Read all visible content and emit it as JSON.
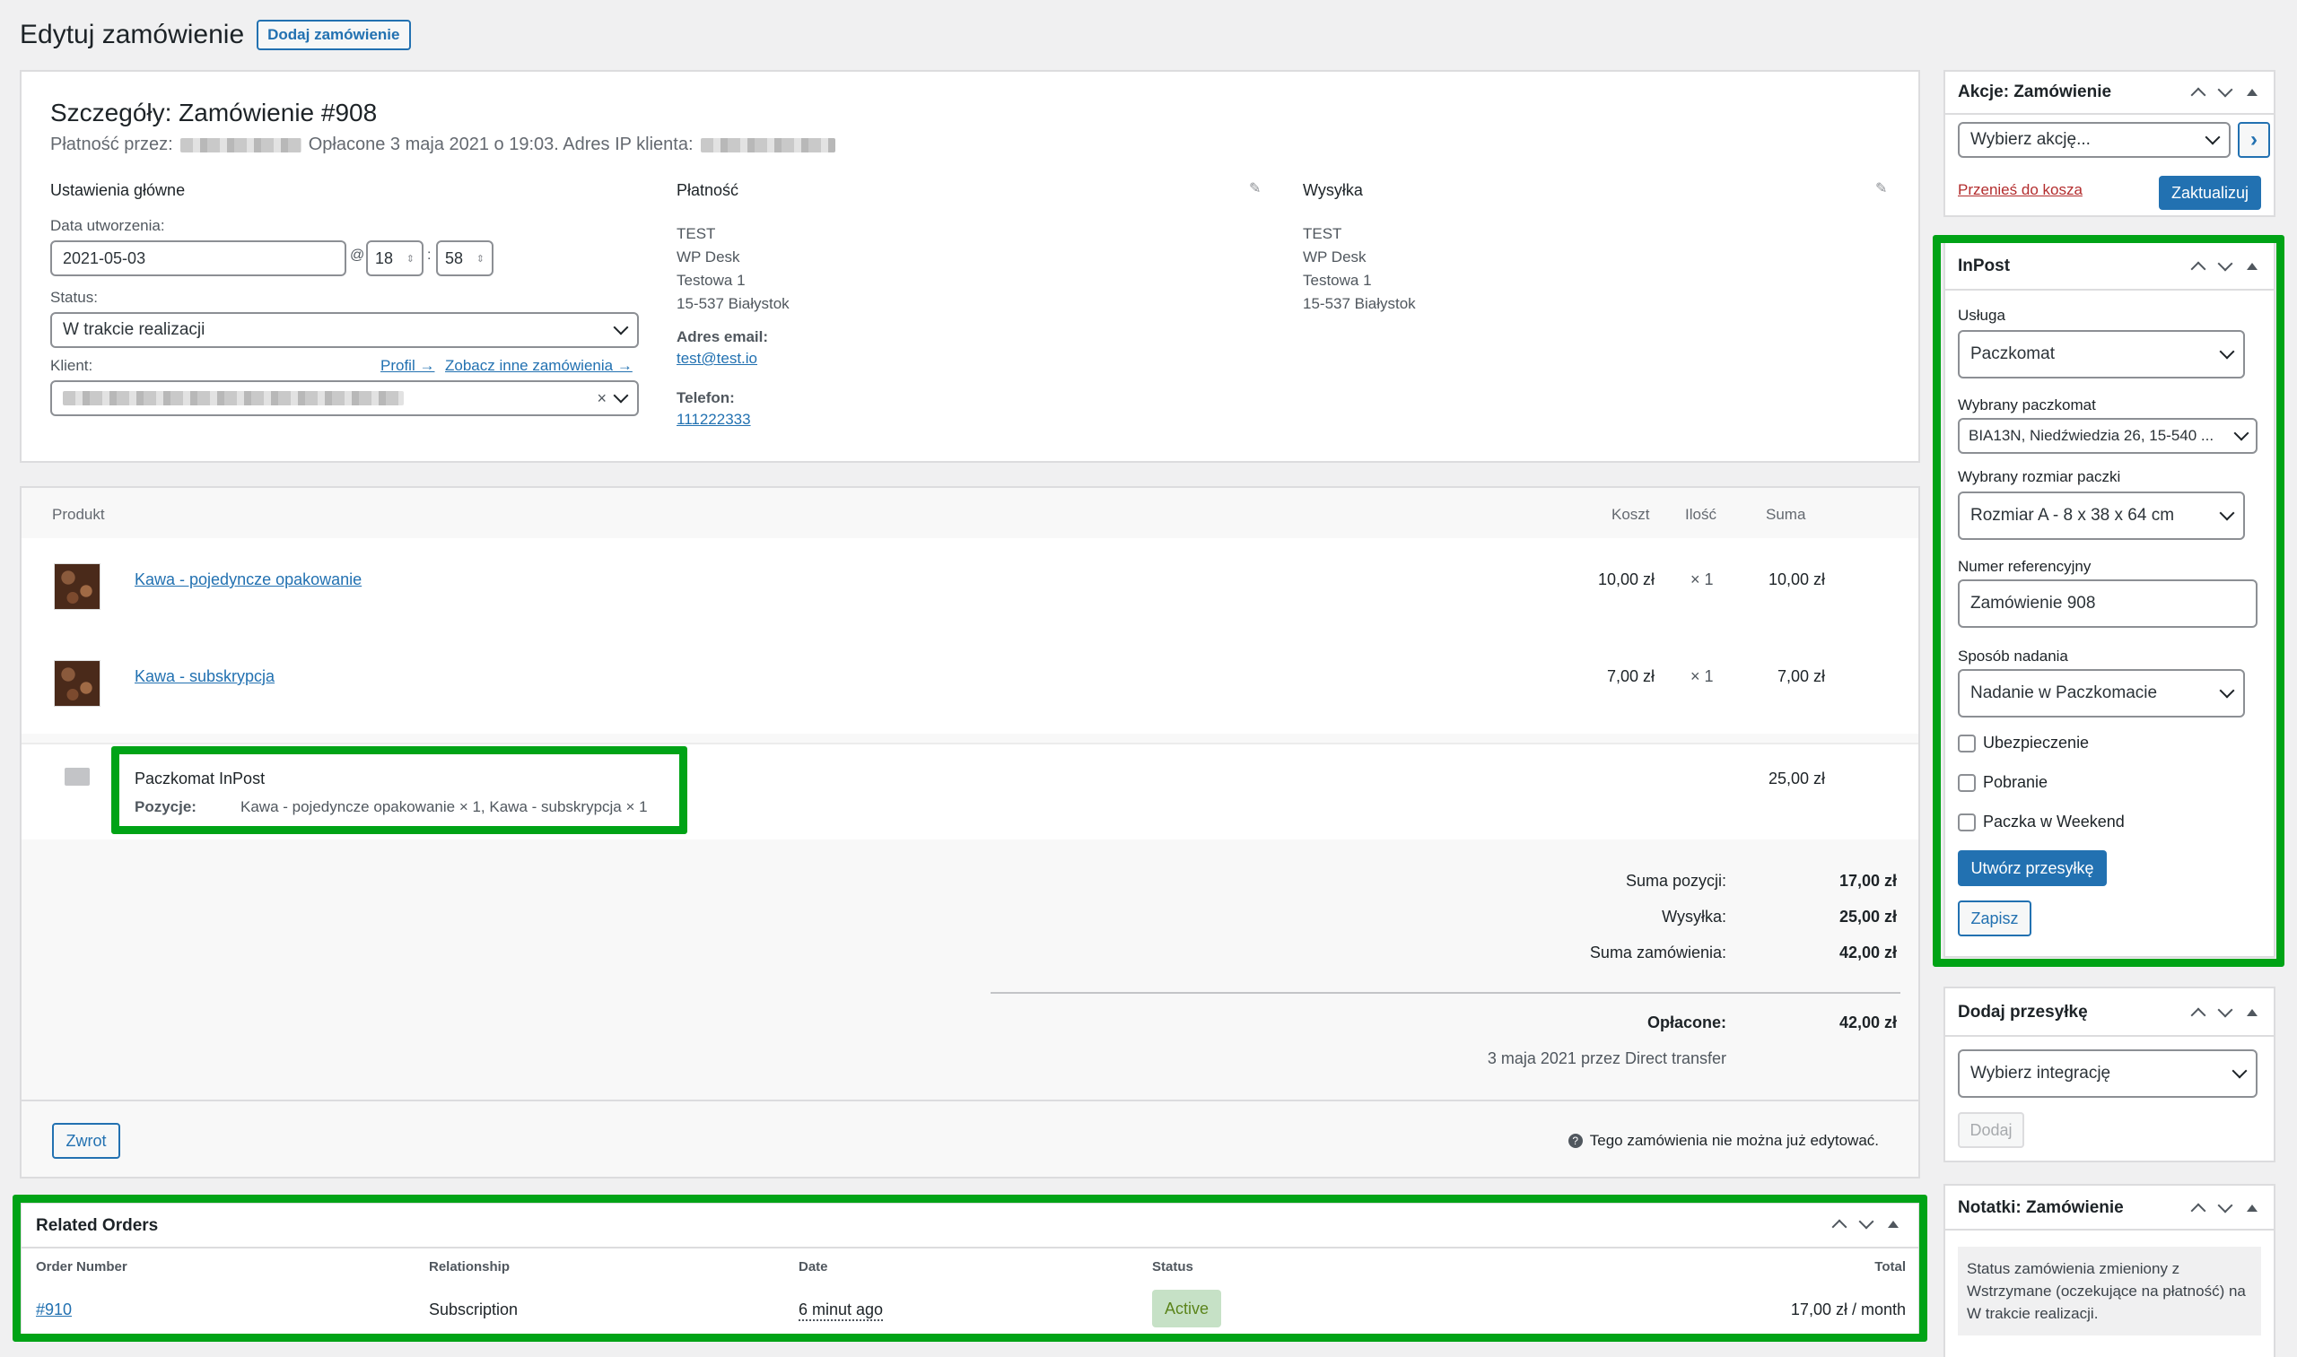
{
  "page": {
    "title": "Edytuj zamówienie",
    "add_order_btn": "Dodaj zamówienie"
  },
  "order": {
    "heading": "Szczegóły: Zamówienie #908",
    "payment_via": "Płatność przez:",
    "paid_info": "Opłacone 3 maja 2021 o 19:03. Adres IP klienta:",
    "general_title": "Ustawienia główne",
    "created_label": "Data utworzenia:",
    "date_value": "2021-05-03",
    "at_sign": "@",
    "hour": "18",
    "colon": ":",
    "minute": "58",
    "status_label": "Status:",
    "status_value": "W trakcie realizacji",
    "client_label": "Klient:",
    "profile_link": "Profil →",
    "other_orders_link": "Zobacz inne zamówienia →",
    "client_clear": "×"
  },
  "billing": {
    "title": "Płatność",
    "lines": [
      "TEST",
      "WP Desk",
      "Testowa 1",
      "15-537 Białystok"
    ],
    "email_label": "Adres email:",
    "email": "test@test.io",
    "phone_label": "Telefon:",
    "phone": "111222333"
  },
  "shipping": {
    "title": "Wysyłka",
    "lines": [
      "TEST",
      "WP Desk",
      "Testowa 1",
      "15-537 Białystok"
    ]
  },
  "items": {
    "col_product": "Produkt",
    "col_cost": "Koszt",
    "col_qty": "Ilość",
    "col_total": "Suma",
    "rows": [
      {
        "name": "Kawa - pojedyncze opakowanie",
        "cost": "10,00 zł",
        "qty": "× 1",
        "total": "10,00 zł"
      },
      {
        "name": "Kawa - subskrypcja",
        "cost": "7,00 zł",
        "qty": "× 1",
        "total": "7,00 zł"
      }
    ],
    "shipping_name": "Paczkomat InPost",
    "shipping_items_label": "Pozycje:",
    "shipping_items": "Kawa - pojedyncze opakowanie × 1, Kawa - subskrypcja × 1",
    "shipping_total": "25,00 zł"
  },
  "totals": {
    "items_label": "Suma pozycji:",
    "items_value": "17,00 zł",
    "shipping_label": "Wysyłka:",
    "shipping_value": "25,00 zł",
    "order_label": "Suma zamówienia:",
    "order_value": "42,00 zł",
    "paid_label": "Opłacone:",
    "paid_value": "42,00 zł",
    "paid_note": "3 maja 2021 przez Direct transfer",
    "refund_btn": "Zwrot",
    "not_editable": "Tego zamówienia nie można już edytować."
  },
  "related": {
    "title": "Related Orders",
    "col_number": "Order Number",
    "col_relationship": "Relationship",
    "col_date": "Date",
    "col_status": "Status",
    "col_total": "Total",
    "row": {
      "number": "#910",
      "relationship": "Subscription",
      "date": "6 minut ago",
      "status": "Active",
      "total": "17,00 zł / month"
    }
  },
  "actions_box": {
    "title": "Akcje: Zamówienie",
    "select": "Wybierz akcję...",
    "go": "›",
    "trash": "Przenieś do kosza",
    "update": "Zaktualizuj"
  },
  "inpost": {
    "title": "InPost",
    "service_label": "Usługa",
    "service_value": "Paczkomat",
    "locker_label": "Wybrany paczkomat",
    "locker_value": "BIA13N, Niedźwiedzia 26, 15-540 ...",
    "size_label": "Wybrany rozmiar paczki",
    "size_value": "Rozmiar A - 8 x 38 x 64 cm",
    "ref_label": "Numer referencyjny",
    "ref_value": "Zamówienie 908",
    "send_label": "Sposób nadania",
    "send_value": "Nadanie w Paczkomacie",
    "insurance": "Ubezpieczenie",
    "cod": "Pobranie",
    "weekend": "Paczka w Weekend",
    "create_btn": "Utwórz przesyłkę",
    "save_btn": "Zapisz"
  },
  "add_shipment": {
    "title": "Dodaj przesyłkę",
    "select": "Wybierz integrację",
    "add_btn": "Dodaj"
  },
  "notes": {
    "title": "Notatki: Zamówienie",
    "note": "Status zamówienia zmieniony z Wstrzymane (oczekujące na płatność) na W trakcie realizacji."
  },
  "colors": {
    "accent": "#2271b1",
    "highlight": "#00a316",
    "active_badge": "#c6e1c6"
  }
}
